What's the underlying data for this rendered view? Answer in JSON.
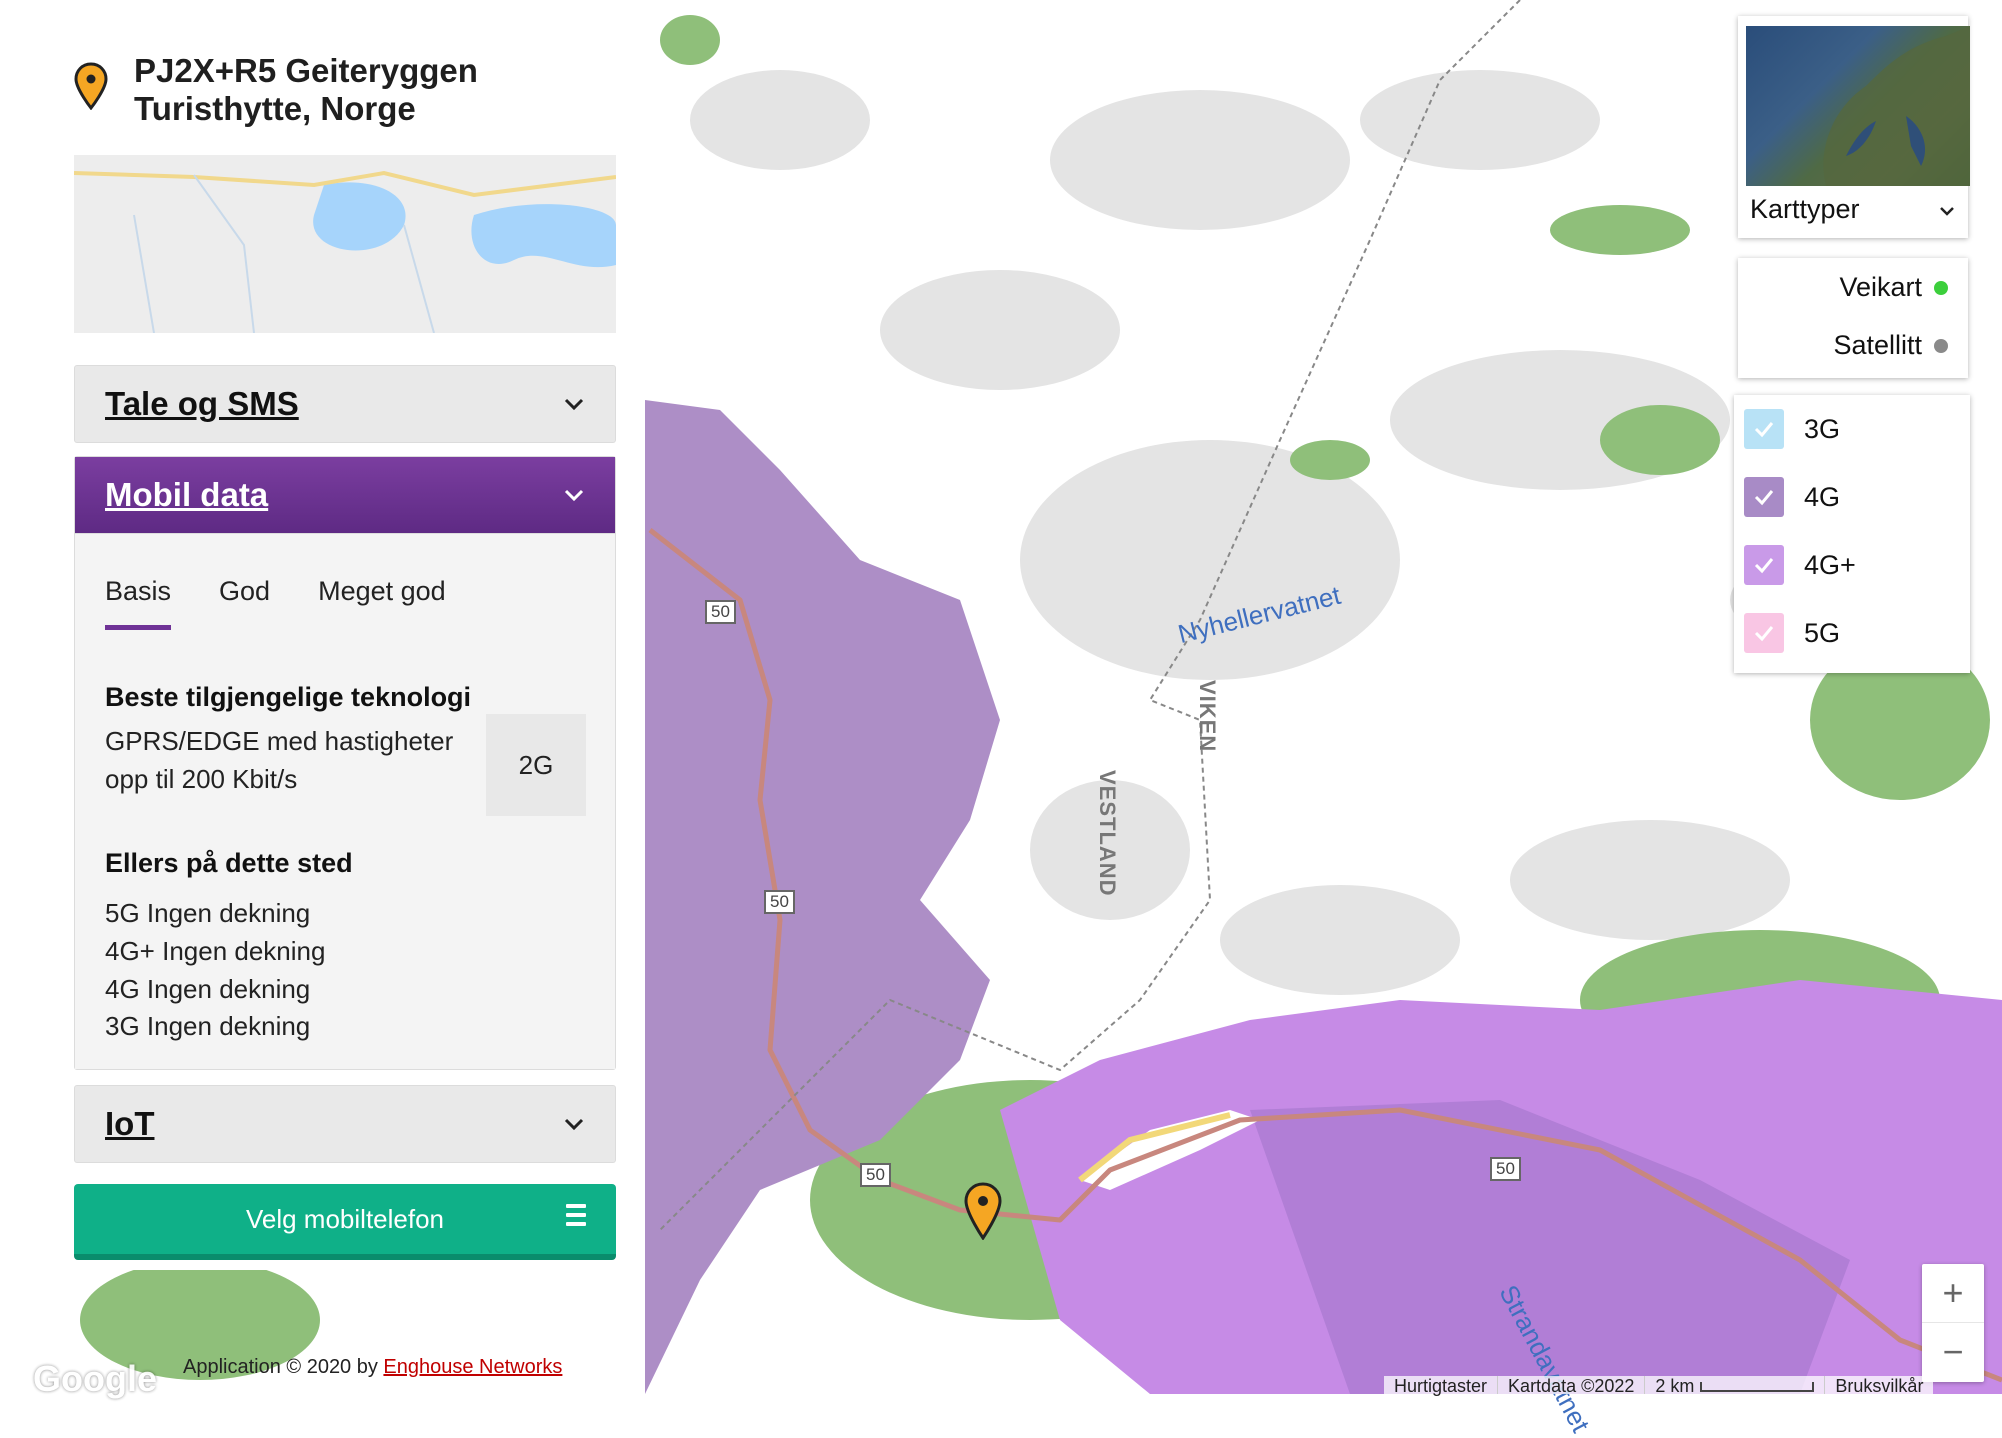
{
  "location": {
    "title_line1": "PJ2X+R5 Geiteryggen",
    "title_line2": "Turisthytte, Norge"
  },
  "accordions": {
    "voice": {
      "title": "Tale og SMS"
    },
    "data": {
      "title": "Mobil data"
    },
    "iot": {
      "title": "IoT"
    }
  },
  "tabs": [
    "Basis",
    "God",
    "Meget god"
  ],
  "best_tech": {
    "heading": "Beste tilgjengelige teknologi",
    "description_line1": "GPRS/EDGE med hastigheter",
    "description_line2": "opp til 200 Kbit/s",
    "badge": "2G"
  },
  "elsewhere": {
    "heading": "Ellers på dette sted",
    "items": [
      "5G Ingen dekning",
      "4G+ Ingen dekning",
      "4G Ingen dekning",
      "3G Ingen dekning"
    ]
  },
  "phone_button": {
    "label": "Velg mobiltelefon"
  },
  "credit": {
    "prefix": "Application © 2020 by ",
    "link": "Enghouse Networks"
  },
  "map_types": {
    "label": "Karttyper",
    "options": [
      {
        "label": "Veikart",
        "color": "#3ccf3c"
      },
      {
        "label": "Satellitt",
        "color": "#8a8a8a"
      }
    ]
  },
  "layers": [
    {
      "label": "3G",
      "color": "#b8e2f6"
    },
    {
      "label": "4G",
      "color": "#a88bc6"
    },
    {
      "label": "4G+",
      "color": "#c99ae8"
    },
    {
      "label": "5G",
      "color": "#f9c6e4"
    }
  ],
  "map_labels": {
    "lake1": "Nyhellervatnet",
    "lake2": "Strandavatnet",
    "region1": "VESTLAND",
    "region2": "VIKEN",
    "road": "50",
    "corner_region1": "VEST",
    "corner_region2": "VIKE",
    "edge_fragment": "ne"
  },
  "zoom": {
    "in": "+",
    "out": "−"
  },
  "footer": {
    "shortcuts": "Hurtigtaster",
    "mapdata": "Kartdata ©2022",
    "scale": "2 km",
    "terms": "Bruksvilkår"
  },
  "google_logo": "Google"
}
